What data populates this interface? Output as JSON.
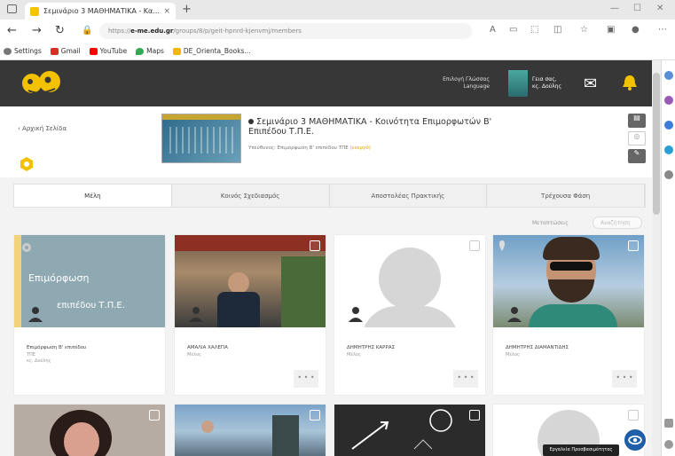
{
  "browser": {
    "tab_title": "Σεμινάριο 3 ΜΑΘΗΜΑΤΙΚΑ - Κα...",
    "tab_close": "×",
    "new_tab": "+",
    "url_prefix": "https://",
    "url_domain": "e-me.edu.gr",
    "url_path": "/groups/8/p/geit-hpnrd-kjenvmj/members",
    "bookmarks": [
      {
        "label": "Settings",
        "color": "#777777"
      },
      {
        "label": "Gmail",
        "color": "#d93025"
      },
      {
        "label": "YouTube",
        "color": "#ff0000"
      },
      {
        "label": "Maps",
        "color": "#34a853"
      },
      {
        "label": "DE_Orienta_Books...",
        "color": "#f2b705"
      }
    ]
  },
  "topbar": {
    "lang_line1": "Επιλογή Γλώσσας",
    "lang_line2": "Language",
    "user_line1": "Γεια σας,",
    "user_line2": "κς. Δούλης"
  },
  "header": {
    "back_label": "Αρχική Σελίδα",
    "course_title": "Σεμινάριο 3 ΜΑΘΗΜΑΤΙΚΑ - Κοινότητα Επιμορφωτών Β' Επιπέδου Τ.Π.Ε.",
    "course_sub_prefix": "Υπεύθυνος: Επιμόρφωση Β' επιπέδου ΤΠΕ",
    "course_sub_hl": "(ενεργό)"
  },
  "tabs": [
    {
      "label": "Μέλη",
      "active": true
    },
    {
      "label": "Κοινός Σχεδιασμός",
      "active": false
    },
    {
      "label": "Αποστολέας Πρακτικής",
      "active": false
    },
    {
      "label": "Τρέχουσα Φάση",
      "active": false
    }
  ],
  "filter": {
    "label": "Μεταπτώσεις",
    "search_placeholder": "Αναζήτηση"
  },
  "cards": [
    {
      "name": "Επιμόρφωση Β' επιπέδου",
      "role": "ΤΠΕ",
      "extra": "κς. Δούλης",
      "banner_line1": "Επιμόρφωση",
      "banner_line2": "επιπέδου Τ.Π.Ε."
    },
    {
      "name": "ΑΜΑΛΙΑ ΧΑΛΕΠΑ",
      "role": "Μέλος",
      "extra": ""
    },
    {
      "name": "ΔΗΜΗΤΡΗΣ ΚΑΡΡΑΣ",
      "role": "Μέλος",
      "extra": ""
    },
    {
      "name": "ΔΗΜΗΤΡΗΣ ΔΙΑΜΑΝΤΙΔΗΣ",
      "role": "Μέλος",
      "extra": ""
    }
  ],
  "more_label": "• • •",
  "tooltip": "Εργαλεία Προσβασιμότητας"
}
